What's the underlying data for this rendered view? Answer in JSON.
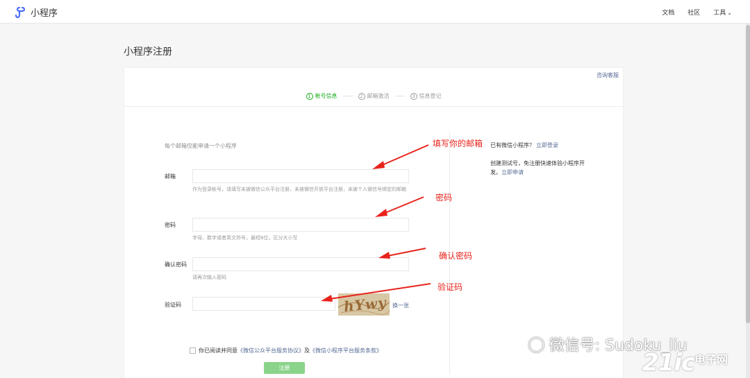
{
  "header": {
    "app_name": "小程序",
    "nav": [
      "文档",
      "社区",
      "工具"
    ],
    "brand_color": "#4b6cff"
  },
  "page": {
    "title": "小程序注册"
  },
  "card": {
    "service_link": "咨询客服",
    "steps": [
      {
        "num": "1",
        "label": "帐号信息",
        "active": true
      },
      {
        "num": "2",
        "label": "邮箱激活",
        "active": false
      },
      {
        "num": "3",
        "label": "信息登记",
        "active": false
      }
    ]
  },
  "form": {
    "tip": "每个邮箱仅能申请一个小程序",
    "email": {
      "label": "邮箱",
      "value": "",
      "hint": "作为登录帐号，请填写未被微信公众平台注册，未被微信开放平台注册，未被个人微信号绑定的邮箱"
    },
    "password": {
      "label": "密码",
      "value": "",
      "hint": "字母、数字或者英文符号，最短8位，区分大小写"
    },
    "confirm": {
      "label": "确认密码",
      "value": "",
      "hint": "请再次输入密码"
    },
    "captcha": {
      "label": "验证码",
      "value": "",
      "image_text": "hYwy",
      "refresh": "换一张"
    },
    "agree": {
      "prefix": "你已阅读并同意",
      "link1": "《微信公众平台服务协议》",
      "mid": "及",
      "link2": "《微信小程序平台服务条款》"
    },
    "submit": "注册"
  },
  "side": {
    "has_account": "已有微信小程序？",
    "login_link": "立即登录",
    "test_text": "创建测试号，免注册快速体验小程序开发。",
    "apply_link": "立即申请"
  },
  "annotations": {
    "email": "填写你的邮箱",
    "password": "密码",
    "confirm": "确认密码",
    "captcha": "验证码",
    "color": "#e8221b"
  },
  "watermark": {
    "wechat": "微信号: Sudoku_liu",
    "logo": "21ic",
    "sub": "电子网"
  }
}
